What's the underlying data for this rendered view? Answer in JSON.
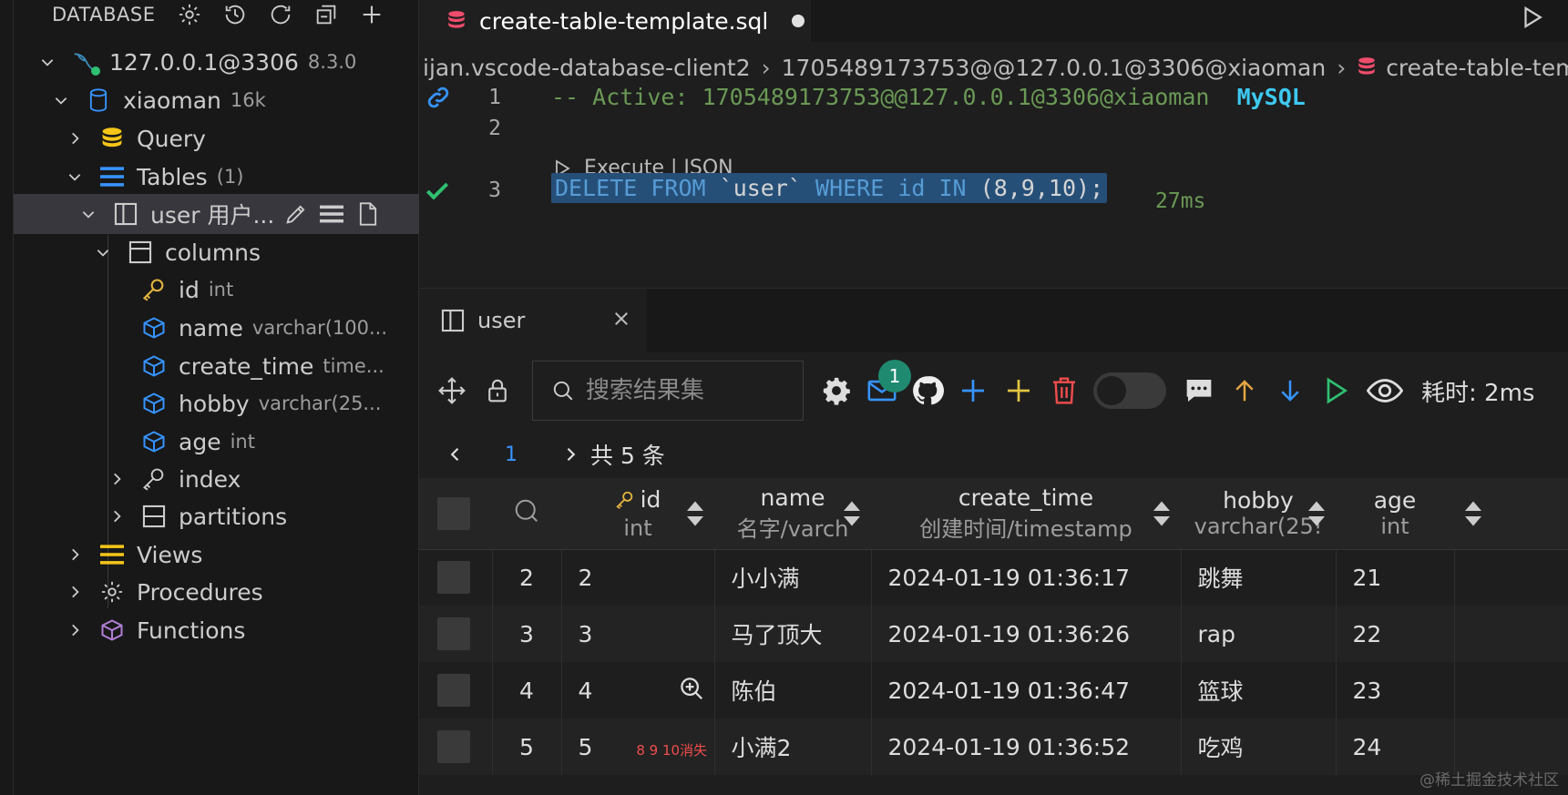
{
  "sidebar": {
    "title": "DATABASE",
    "connection": {
      "label": "127.0.0.1@3306",
      "version": "8.3.0"
    },
    "database": {
      "label": "xiaoman",
      "size": "16k"
    },
    "query": "Query",
    "tables": {
      "label": "Tables",
      "count": "(1)"
    },
    "table_user": {
      "label": "user 用户..."
    },
    "columns_label": "columns",
    "columns": [
      {
        "name": "id",
        "type": "int"
      },
      {
        "name": "name",
        "type": "varchar(100..."
      },
      {
        "name": "create_time",
        "type": "time..."
      },
      {
        "name": "hobby",
        "type": "varchar(25..."
      },
      {
        "name": "age",
        "type": "int"
      }
    ],
    "index": "index",
    "partitions": "partitions",
    "views": "Views",
    "procedures": "Procedures",
    "functions": "Functions"
  },
  "editor": {
    "tab_title": "create-table-template.sql",
    "breadcrumbs": [
      "ijan.vscode-database-client2",
      "1705489173753@@127.0.0.1@3306@xiaoman",
      "create-table-template"
    ],
    "line1_comment": "-- Active: 1705489173753@@127.0.0.1@3306@xiaoman",
    "line1_dialect": "MySQL",
    "codelens": "Execute | JSON",
    "line_numbers": [
      "1",
      "2",
      "3"
    ],
    "sql": {
      "kw1": "DELETE FROM",
      "table": "`user`",
      "kw2": "WHERE id IN",
      "rest": "(8,9,10);"
    },
    "elapsed": "27ms"
  },
  "result": {
    "tab_label": "user",
    "search_placeholder": "搜索结果集",
    "badge_count": "1",
    "elapsed_label": "耗时: 2ms",
    "page": "1",
    "total": "共 5 条",
    "headers": [
      {
        "name": "id",
        "type": "int"
      },
      {
        "name": "name",
        "type": "名字/varch"
      },
      {
        "name": "create_time",
        "type": "创建时间/timestamp"
      },
      {
        "name": "hobby",
        "type": "varchar(25!"
      },
      {
        "name": "age",
        "type": "int"
      }
    ],
    "rows": [
      {
        "num": "2",
        "id": "2",
        "name": "小小满",
        "create_time": "2024-01-19 01:36:17",
        "hobby": "跳舞",
        "age": "21"
      },
      {
        "num": "3",
        "id": "3",
        "name": "马了顶大",
        "create_time": "2024-01-19 01:36:26",
        "hobby": "rap",
        "age": "22"
      },
      {
        "num": "4",
        "id": "4",
        "name": "陈伯",
        "create_time": "2024-01-19 01:36:47",
        "hobby": "篮球",
        "age": "23"
      },
      {
        "num": "5",
        "id": "5",
        "name": "小满2",
        "create_time": "2024-01-19 01:36:52",
        "hobby": "吃鸡",
        "age": "24"
      }
    ],
    "annotation": "8 9  10消失"
  },
  "watermark": "@稀土掘金技术社区",
  "colors": {
    "accent": "#3794ff",
    "success": "#2fbf71",
    "comment": "#6a9955",
    "keyword": "#569cd6"
  }
}
